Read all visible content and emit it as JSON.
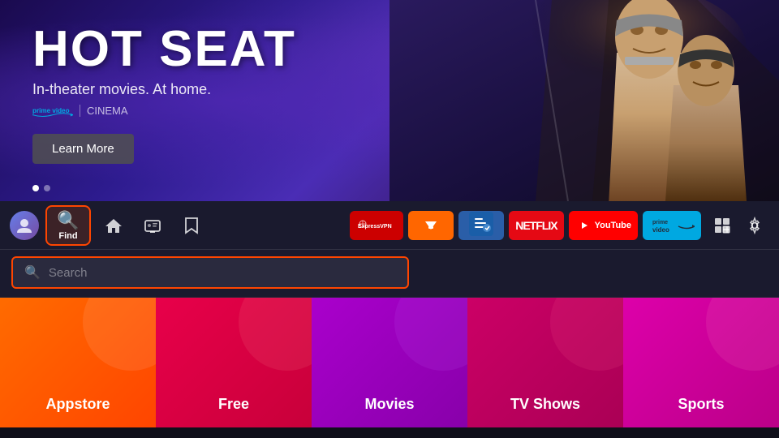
{
  "hero": {
    "title": "HOT SEAT",
    "subtitle": "In-theater movies. At home.",
    "brand_prime": "prime video",
    "brand_separator": "|",
    "brand_cinema": "CINEMA",
    "learn_more_btn": "Learn More",
    "dots": [
      {
        "active": true
      },
      {
        "active": false
      }
    ]
  },
  "navbar": {
    "find_label": "Find",
    "apps": [
      {
        "name": "ExpressVPN",
        "key": "expressvpn"
      },
      {
        "name": "Downloader",
        "key": "downloader"
      },
      {
        "name": "FileLinked",
        "key": "filelinked"
      },
      {
        "name": "NETFLIX",
        "key": "netflix"
      },
      {
        "name": "YouTube",
        "key": "youtube"
      },
      {
        "name": "prime video",
        "key": "prime"
      }
    ]
  },
  "search": {
    "placeholder": "Search"
  },
  "categories": [
    {
      "label": "Appstore",
      "key": "appstore"
    },
    {
      "label": "Free",
      "key": "free"
    },
    {
      "label": "Movies",
      "key": "movies"
    },
    {
      "label": "TV Shows",
      "key": "tvshows"
    },
    {
      "label": "Sports",
      "key": "sports"
    }
  ]
}
